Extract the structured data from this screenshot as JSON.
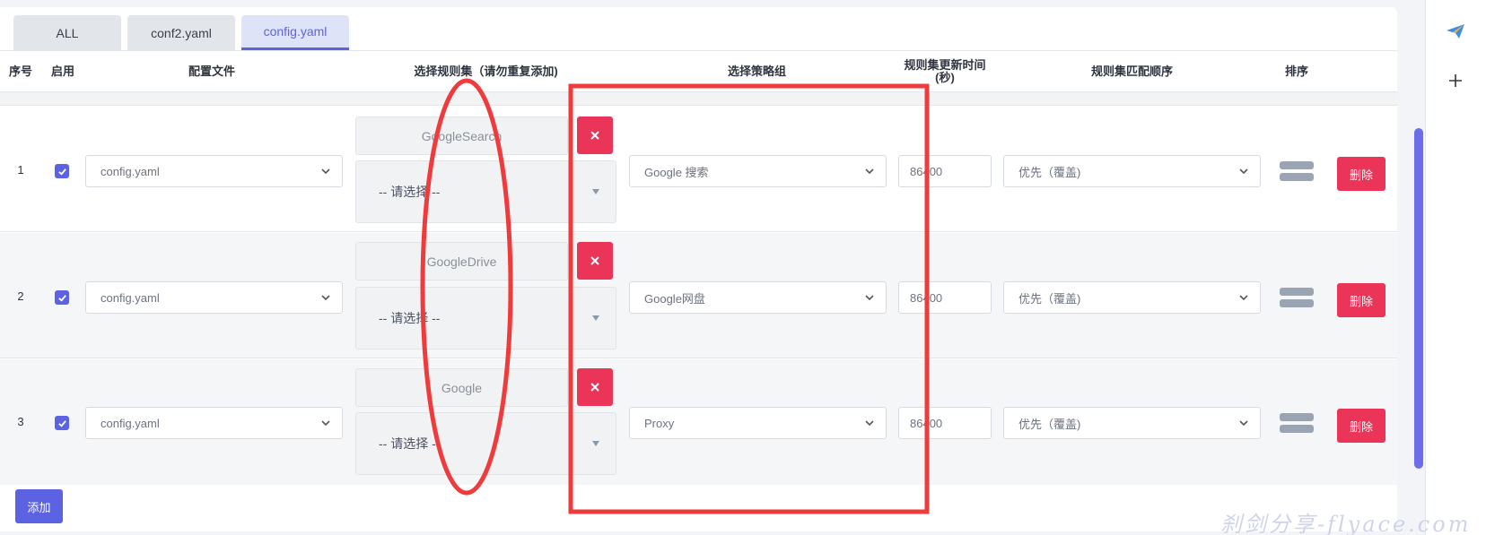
{
  "tabs": [
    {
      "label": "ALL"
    },
    {
      "label": "conf2.yaml"
    },
    {
      "label": "config.yaml",
      "active": true
    }
  ],
  "columns": {
    "index": "序号",
    "enabled": "启用",
    "config_file": "配置文件",
    "rule_set": "选择规则集（请勿重复添加)",
    "policy_group": "选择策略组",
    "update_interval": "规则集更新时间(秒)",
    "match_order": "规则集匹配顺序",
    "sort": "排序"
  },
  "rows": [
    {
      "index": "1",
      "enabled": true,
      "config_file": "config.yaml",
      "rule_set": "GoogleSearch",
      "rule_select_placeholder": "-- 请选择 --",
      "policy_group": "Google 搜索",
      "interval": "86400",
      "order": "优先（覆盖)",
      "delete_label": "删除"
    },
    {
      "index": "2",
      "enabled": true,
      "config_file": "config.yaml",
      "rule_set": "GoogleDrive",
      "rule_select_placeholder": "-- 请选择 --",
      "policy_group": "Google网盘",
      "interval": "86400",
      "order": "优先（覆盖)",
      "delete_label": "删除"
    },
    {
      "index": "3",
      "enabled": true,
      "config_file": "config.yaml",
      "rule_set": "Google",
      "rule_select_placeholder": "-- 请选择 --",
      "policy_group": "Proxy",
      "interval": "86400",
      "order": "优先（覆盖)",
      "delete_label": "删除"
    }
  ],
  "add_label": "添加",
  "watermark": "刹剑分享-flyace.com",
  "icons": {
    "chevron": "chevron-down-icon",
    "check": "check-icon",
    "close": "close-icon",
    "drag": "drag-handle-icon",
    "send": "send-icon",
    "plus": "plus-icon"
  },
  "colors": {
    "accent": "#5b63e3",
    "danger": "#ea3458",
    "annotation": "#ef3b3b"
  }
}
